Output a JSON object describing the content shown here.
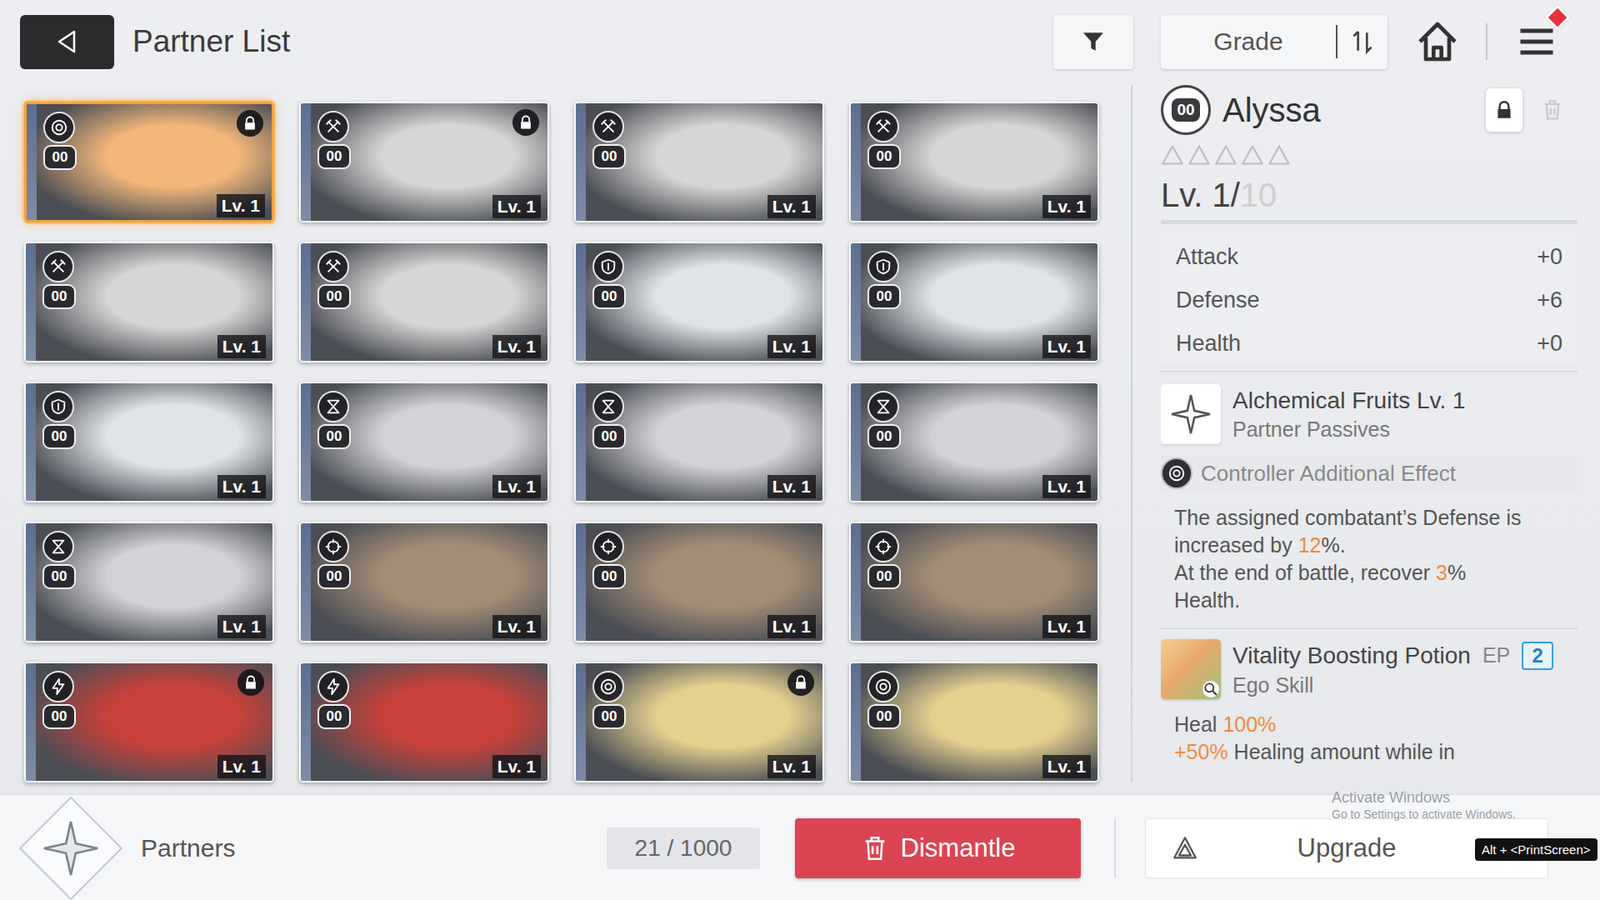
{
  "top_bar": {
    "title": "Partner List",
    "sort_label": "Grade",
    "menu_alert": true
  },
  "cards": [
    {
      "kind": "controller",
      "color": "#f3b77a",
      "badge": "00",
      "level": "Lv. 1",
      "locked": true,
      "selected": true
    },
    {
      "kind": "striker",
      "color": "#d6d6d4",
      "badge": "00",
      "level": "Lv. 1",
      "locked": true,
      "selected": false
    },
    {
      "kind": "striker",
      "color": "#d6d6d4",
      "badge": "00",
      "level": "Lv. 1",
      "locked": false,
      "selected": false
    },
    {
      "kind": "striker",
      "color": "#d6d6d4",
      "badge": "00",
      "level": "Lv. 1",
      "locked": false,
      "selected": false
    },
    {
      "kind": "striker",
      "color": "#d6d6d4",
      "badge": "00",
      "level": "Lv. 1",
      "locked": false,
      "selected": false
    },
    {
      "kind": "striker",
      "color": "#d6d6d4",
      "badge": "00",
      "level": "Lv. 1",
      "locked": false,
      "selected": false
    },
    {
      "kind": "defender",
      "color": "#e0e3e7",
      "badge": "00",
      "level": "Lv. 1",
      "locked": false,
      "selected": false
    },
    {
      "kind": "defender",
      "color": "#e0e3e7",
      "badge": "00",
      "level": "Lv. 1",
      "locked": false,
      "selected": false
    },
    {
      "kind": "defender",
      "color": "#e0e3e7",
      "badge": "00",
      "level": "Lv. 1",
      "locked": false,
      "selected": false
    },
    {
      "kind": "ranger",
      "color": "#d2d3d6",
      "badge": "00",
      "level": "Lv. 1",
      "locked": false,
      "selected": false
    },
    {
      "kind": "ranger",
      "color": "#d2d3d6",
      "badge": "00",
      "level": "Lv. 1",
      "locked": false,
      "selected": false
    },
    {
      "kind": "ranger",
      "color": "#d2d3d6",
      "badge": "00",
      "level": "Lv. 1",
      "locked": false,
      "selected": false
    },
    {
      "kind": "ranger",
      "color": "#d2d3d6",
      "badge": "00",
      "level": "Lv. 1",
      "locked": false,
      "selected": false
    },
    {
      "kind": "buster",
      "color": "#a48d76",
      "badge": "00",
      "level": "Lv. 1",
      "locked": false,
      "selected": false
    },
    {
      "kind": "buster",
      "color": "#a48d76",
      "badge": "00",
      "level": "Lv. 1",
      "locked": false,
      "selected": false
    },
    {
      "kind": "buster",
      "color": "#a48d76",
      "badge": "00",
      "level": "Lv. 1",
      "locked": false,
      "selected": false
    },
    {
      "kind": "psionic",
      "color": "#c8413a",
      "badge": "00",
      "level": "Lv. 1",
      "locked": true,
      "selected": false
    },
    {
      "kind": "psionic",
      "color": "#c8413a",
      "badge": "00",
      "level": "Lv. 1",
      "locked": false,
      "selected": false
    },
    {
      "kind": "controller",
      "color": "#e4d08f",
      "badge": "00",
      "level": "Lv. 1",
      "locked": true,
      "selected": false
    },
    {
      "kind": "controller",
      "color": "#e4d08f",
      "badge": "00",
      "level": "Lv. 1",
      "locked": false,
      "selected": false
    }
  ],
  "detail": {
    "badge": "00",
    "name": "Alyssa",
    "locked": true,
    "delete_disabled": true,
    "stars": 0,
    "star_slots": 5,
    "level_text": "Lv. 1/",
    "level_max": "10",
    "level": 0,
    "stats": [
      {
        "label": "Attack",
        "value": "+0"
      },
      {
        "label": "Defense",
        "value": "+6"
      },
      {
        "label": "Health",
        "value": "+0"
      }
    ],
    "passive": {
      "title": "Alchemical Fruits Lv. 1",
      "subtitle": "Partner Passives",
      "effect_label": "Controller Additional Effect",
      "effect_kind": "controller",
      "description": [
        [
          {
            "text": "The assigned combatant’s Defense is",
            "highlight": false
          }
        ],
        [
          {
            "text": "increased by ",
            "highlight": false
          },
          {
            "text": "12",
            "highlight": true
          },
          {
            "text": "%.",
            "highlight": false
          }
        ],
        [
          {
            "text": "At the end of battle, recover ",
            "highlight": false
          },
          {
            "text": "3",
            "highlight": true
          },
          {
            "text": "%",
            "highlight": false
          }
        ],
        [
          {
            "text": "Health.",
            "highlight": false
          }
        ]
      ]
    },
    "ego": {
      "title": "Vitality Boosting Potion",
      "subtitle": "Ego Skill",
      "cost_label": "EP",
      "cost": "2",
      "lines": [
        [
          {
            "text": "Heal ",
            "highlight": false
          },
          {
            "text": "100%",
            "highlight": true
          }
        ],
        [
          {
            "text": "+50%",
            "highlight": true
          },
          {
            "text": " Healing amount while in",
            "highlight": false
          }
        ]
      ]
    }
  },
  "bottom_bar": {
    "section": "Partners",
    "count": "21 / 1000",
    "dismantle": "Dismantle",
    "upgrade": "Upgrade"
  },
  "overlays": {
    "watermark": [
      "Activate Windows",
      "Go to Settings to activate Windows."
    ],
    "shortcut_hint": "Alt + <PrintScreen>"
  }
}
